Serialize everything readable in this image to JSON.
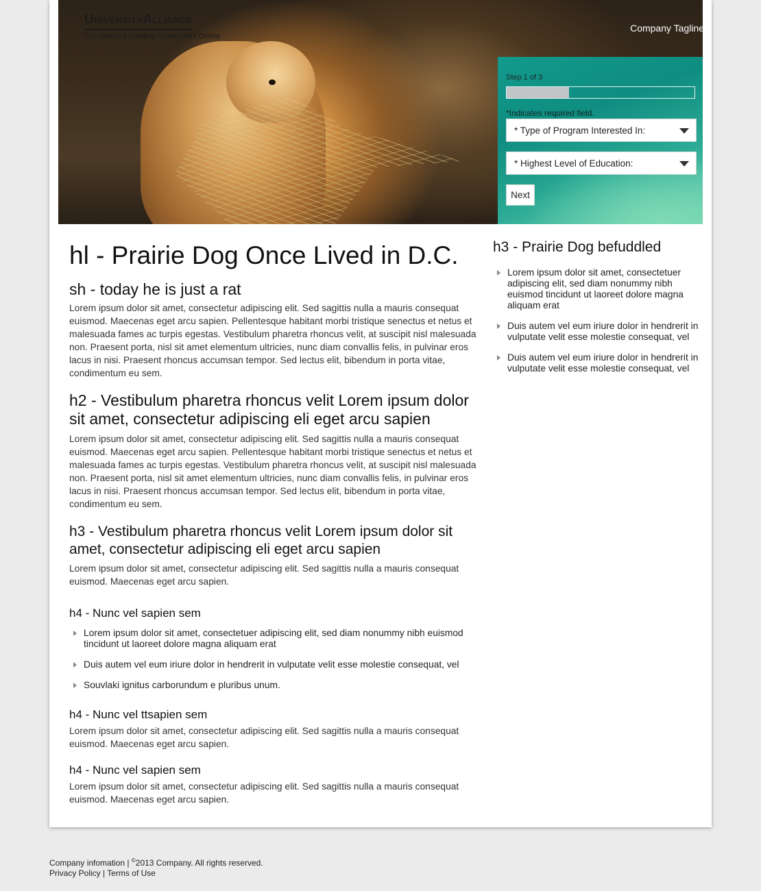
{
  "header": {
    "logo_name": "UniversityAlliance",
    "logo_subtitle": "The Nation's Leading Universities Online",
    "tagline": "Company Tagline"
  },
  "form": {
    "step_label": "Step 1 of 3",
    "progress_fraction": 0.333,
    "required_note": "*Indicates required field.",
    "program_select": "* Type of Program Interested In:",
    "education_select": "* Highest Level of Education:",
    "next_label": "Next"
  },
  "main": {
    "h1": "hl - Prairie Dog Once Lived in D.C.",
    "sh": "sh - today he is just a rat",
    "p1": "Lorem ipsum dolor sit amet, consectetur adipiscing elit. Sed sagittis nulla a mauris consequat euismod. Maecenas eget arcu sapien. Pellentesque habitant morbi tristique senectus et netus et malesuada fames ac turpis egestas. Vestibulum pharetra rhoncus velit, at suscipit nisl malesuada non. Praesent porta, nisl sit amet elementum ultricies, nunc diam convallis felis, in pulvinar eros lacus in nisi. Praesent rhoncus accumsan tempor. Sed lectus elit, bibendum in porta vitae, condimentum eu sem.",
    "h2": "h2 - Vestibulum pharetra rhoncus velit Lorem ipsum dolor sit amet, consectetur adipiscing eli eget arcu sapien",
    "p2": "Lorem ipsum dolor sit amet, consectetur adipiscing elit. Sed sagittis nulla a mauris consequat euismod. Maecenas eget arcu sapien. Pellentesque habitant morbi tristique senectus et netus et malesuada fames ac turpis egestas. Vestibulum pharetra rhoncus velit, at suscipit nisl malesuada non. Praesent porta, nisl sit amet elementum ultricies, nunc diam convallis felis, in pulvinar eros lacus in nisi. Praesent rhoncus accumsan tempor. Sed lectus elit, bibendum in porta vitae, condimentum eu sem.",
    "h3": "h3 - Vestibulum pharetra rhoncus velit Lorem ipsum dolor sit amet, consectetur adipiscing eli eget arcu sapien",
    "p3": "Lorem ipsum dolor sit amet, consectetur adipiscing elit. Sed sagittis nulla a mauris consequat euismod. Maecenas eget arcu sapien.",
    "h4a": "h4 - Nunc vel sapien sem",
    "list": [
      "Lorem ipsum dolor sit amet, consectetuer adipiscing elit, sed diam nonummy nibh euismod tincidunt ut laoreet dolore magna aliquam erat",
      "Duis autem vel eum iriure dolor in hendrerit in vulputate velit esse molestie consequat, vel",
      "Souvlaki ignitus carborundum e pluribus unum."
    ],
    "h4b": "h4 - Nunc vel ttsapien sem",
    "p4": "Lorem ipsum dolor sit amet, consectetur adipiscing elit. Sed sagittis nulla a mauris consequat euismod. Maecenas eget arcu sapien.",
    "h4c": "h4 - Nunc vel sapien sem",
    "p5": "Lorem ipsum dolor sit amet, consectetur adipiscing elit. Sed sagittis nulla a mauris consequat euismod. Maecenas eget arcu sapien."
  },
  "sidebar": {
    "h3": "h3 - Prairie Dog befuddled",
    "list": [
      "Lorem ipsum dolor sit amet, consectetuer adipiscing elit, sed diam nonummy nibh euismod tincidunt ut laoreet dolore magna aliquam erat",
      "Duis autem vel eum iriure dolor in hendrerit in vulputate velit esse molestie consequat, vel",
      "Duis autem vel eum iriure dolor in hendrerit in vulputate velit esse molestie consequat, vel"
    ]
  },
  "footer": {
    "company_info": "Company infomation",
    "copyright_symbol": "©",
    "copyright_text": "2013 Company. All rights reserved.",
    "privacy": "Privacy Policy",
    "terms": "Terms of Use"
  },
  "colors": {
    "form_teal": "#129a8c",
    "page_bg": "#ebebeb"
  }
}
